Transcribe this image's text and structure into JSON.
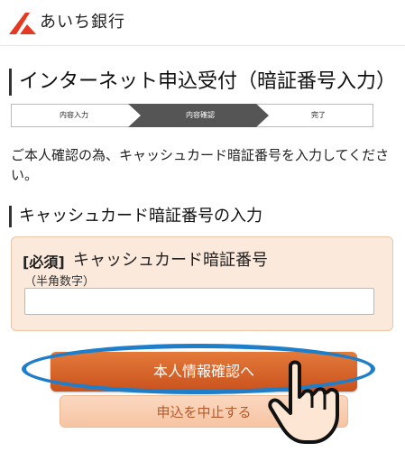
{
  "header": {
    "bank_name": "あいち銀行",
    "logo_color": "#e53922"
  },
  "page": {
    "title": "インターネット申込受付（暗証番号入力）"
  },
  "steps": [
    {
      "label": "内容入力",
      "active": false
    },
    {
      "label": "内容確認",
      "active": true
    },
    {
      "label": "完了",
      "active": false
    }
  ],
  "intro_text": "ご本人確認の為、キャッシュカード暗証番号を入力してください。",
  "section": {
    "title": "キャッシュカード暗証番号の入力"
  },
  "form": {
    "required_tag": "[必須]",
    "field_label": "キャッシュカード暗証番号",
    "field_hint": "（半角数字）",
    "value": "",
    "placeholder": ""
  },
  "buttons": {
    "confirm": "本人情報確認へ",
    "cancel": "申込を中止する"
  },
  "colors": {
    "accent": "#c9521d",
    "step_active": "#555555",
    "highlight": "#1f7ec9"
  },
  "icons": {
    "hand": "pointing-hand-icon",
    "logo": "bank-logo-icon"
  }
}
